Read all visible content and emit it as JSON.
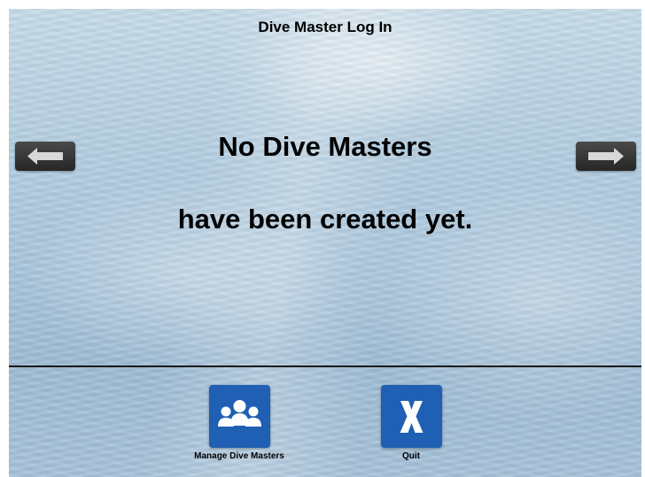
{
  "header": {
    "title": "Dive Master Log In"
  },
  "message": {
    "line1": "No Dive Masters",
    "line2": "have been created yet."
  },
  "nav": {
    "prev_icon": "arrow-left-icon",
    "next_icon": "arrow-right-icon"
  },
  "toolbar": {
    "manage_label": "Manage Dive Masters",
    "manage_icon": "group-people-icon",
    "quit_label": "Quit",
    "quit_icon": "x-icon",
    "tile_color": "#1f5fb4"
  }
}
